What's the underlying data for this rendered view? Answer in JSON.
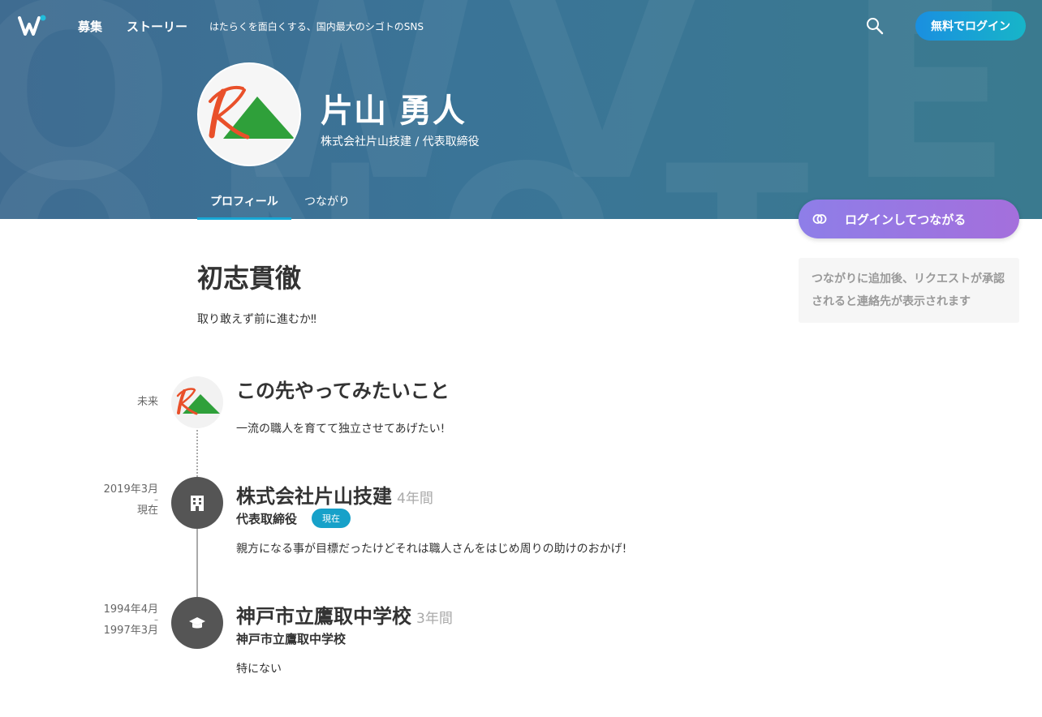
{
  "header": {
    "nav": [
      "募集",
      "ストーリー"
    ],
    "tagline": "はたらくを面白くする、国内最大のシゴトのSNS",
    "login_label": "無料でログイン"
  },
  "profile": {
    "name": "片山 勇人",
    "subtitle": "株式会社片山技建 / 代表取締役",
    "tabs": [
      "プロフィール",
      "つながり"
    ]
  },
  "sidebar": {
    "connect_label": "ログインしてつながる",
    "info_text": "つながりに追加後、リクエストが承認されると連絡先が表示されます"
  },
  "main": {
    "motto_title": "初志貫徹",
    "motto_desc": "取り敢えず前に進むか‼︎"
  },
  "timeline": [
    {
      "date_lines": [
        "未来"
      ],
      "title": "この先やってみたいこと",
      "desc": "一流の職人を育てて独立させてあげたい!"
    },
    {
      "date_lines": [
        "2019年3月",
        "–",
        "現在"
      ],
      "title": "株式会社片山技建",
      "duration": "4年間",
      "role": "代表取締役",
      "badge": "現在",
      "desc": "親方になる事が目標だったけどそれは職人さんをはじめ周りの助けのおかげ!"
    },
    {
      "date_lines": [
        "1994年4月",
        "–",
        "1997年3月"
      ],
      "title": "神戸市立鷹取中学校",
      "duration": "3年間",
      "role": "神戸市立鷹取中学校",
      "desc": "特にない"
    }
  ]
}
